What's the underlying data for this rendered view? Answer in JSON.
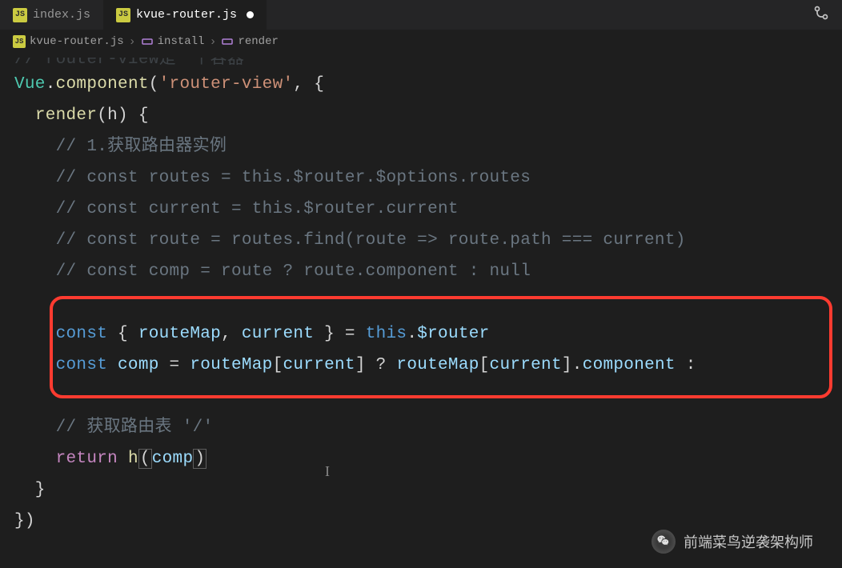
{
  "tabs": [
    {
      "icon": "JS",
      "label": "index.js",
      "active": false,
      "modified": false
    },
    {
      "icon": "JS",
      "label": "kvue-router.js",
      "active": true,
      "modified": true
    }
  ],
  "breadcrumb": {
    "items": [
      {
        "icon": "JS",
        "label": "kvue-router.js"
      },
      {
        "icon": "method",
        "label": "install"
      },
      {
        "icon": "method",
        "label": "render"
      }
    ]
  },
  "code": {
    "line0_comment": "// router-view是一个容器",
    "line1": {
      "vue": "Vue",
      "dot": ".",
      "component": "component",
      "open": "(",
      "string": "'router-view'",
      "comma": ", {",
      "end": ""
    },
    "line2": {
      "indent": "  ",
      "render": "render",
      "paren": "(h) {"
    },
    "line3_comment": "    // 1.获取路由器实例",
    "line4_comment": "    // const routes = this.$router.$options.routes",
    "line5_comment": "    // const current = this.$router.current",
    "line6_comment": "    // const route = routes.find(route => route.path === current)",
    "line7_comment": "    // const comp = route ? route.component : null",
    "line8_empty": "",
    "line9": {
      "indent": "    ",
      "const": "const",
      "space1": " { ",
      "var1": "routeMap",
      "comma": ", ",
      "var2": "current",
      "close": " } = ",
      "this": "this",
      "dot": ".",
      "router": "$router"
    },
    "line10": {
      "indent": "    ",
      "const": "const",
      "space1": " ",
      "comp": "comp",
      "eq": " = ",
      "rm1": "routeMap",
      "br1": "[",
      "cur1": "current",
      "br2": "] ? ",
      "rm2": "routeMap",
      "br3": "[",
      "cur2": "current",
      "br4": "].",
      "component": "component",
      "colon": " :"
    },
    "line11_empty": "",
    "line12_comment": "    // 获取路由表 '/'",
    "line13": {
      "indent": "    ",
      "return": "return",
      "space": " ",
      "h": "h",
      "open": "(",
      "comp": "comp",
      "close": ")"
    },
    "line14": "  }",
    "line15": "})"
  },
  "watermark": {
    "text": "前端菜鸟逆袭架构师"
  }
}
